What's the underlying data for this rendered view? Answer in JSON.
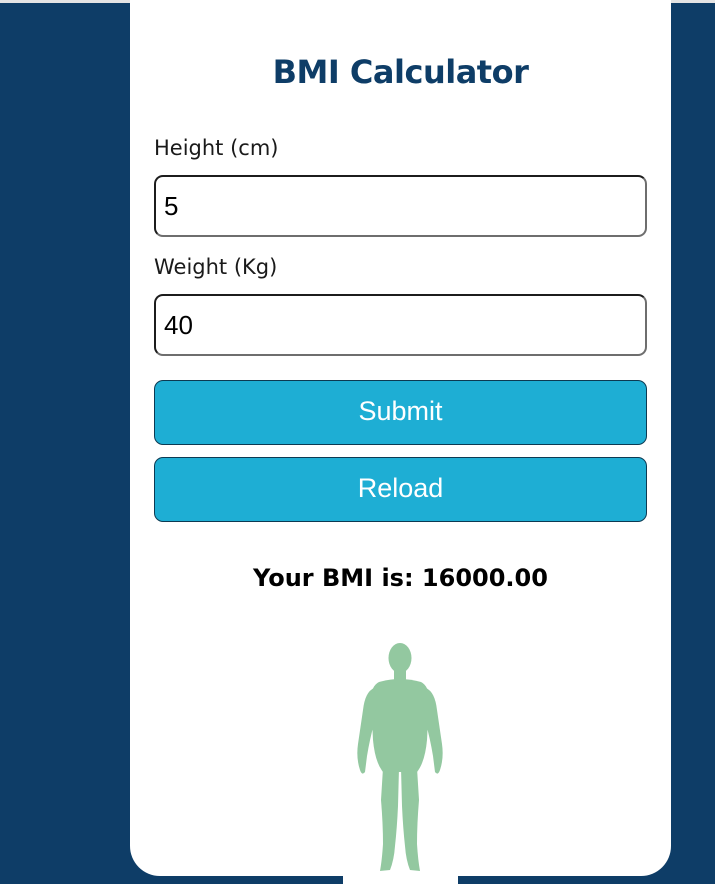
{
  "app": {
    "title": "BMI Calculator"
  },
  "form": {
    "height": {
      "label": "Height (cm)",
      "value": "5"
    },
    "weight": {
      "label": "Weight (Kg)",
      "value": "40"
    },
    "submit_label": "Submit",
    "reload_label": "Reload"
  },
  "result": {
    "text": "Your BMI is: 16000.00"
  },
  "illustration": {
    "icon": "human-body-icon",
    "color": "#93c8a0"
  },
  "colors": {
    "background": "#0e3d67",
    "card": "#ffffff",
    "title": "#0e3d67",
    "button": "#1eaed4"
  }
}
